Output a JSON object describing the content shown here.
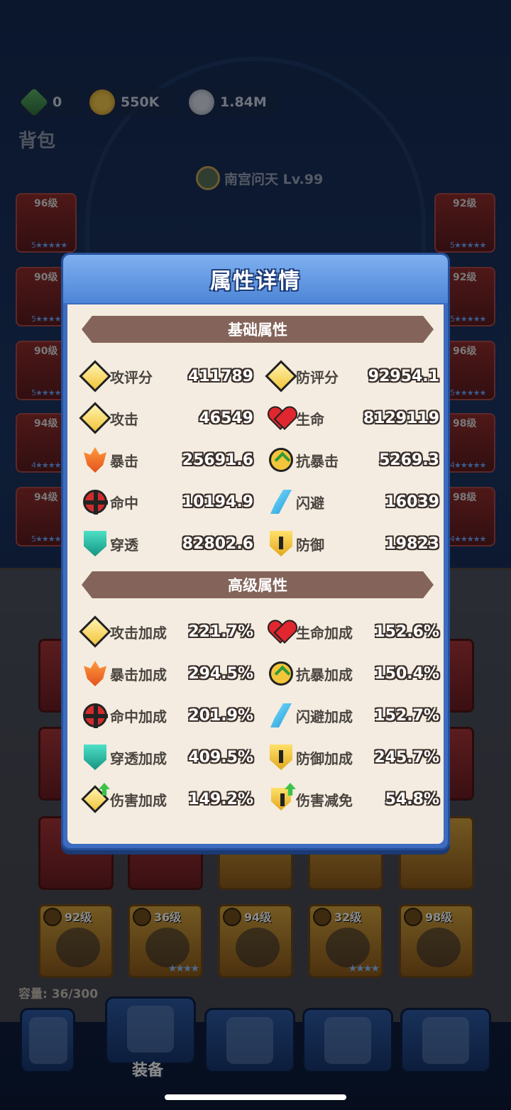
{
  "currency": {
    "gems": "0",
    "gold": "550K",
    "silver": "1.84M"
  },
  "bag_title": "背包",
  "hero": {
    "name": "南宫问天 Lv.99"
  },
  "left_slots": [
    {
      "level": "96级",
      "stars": "5★★★★★"
    },
    {
      "level": "90级",
      "stars": "5★★★★★"
    },
    {
      "level": "90级",
      "stars": "5★★★★★"
    },
    {
      "level": "94级",
      "stars": "4★★★★★"
    },
    {
      "level": "94级",
      "stars": "5★★★★★"
    }
  ],
  "right_slots": [
    {
      "level": "92级",
      "stars": "5★★★★★"
    },
    {
      "level": "92级",
      "stars": "5★★★★★"
    },
    {
      "level": "96级",
      "stars": "5★★★★★"
    },
    {
      "level": "98级",
      "stars": "4★★★★★"
    },
    {
      "level": "98级",
      "stars": "4★★★★★"
    }
  ],
  "inventory_row": [
    {
      "level": "92级",
      "stars": ""
    },
    {
      "level": "36级",
      "stars": "★★★★"
    },
    {
      "level": "94级",
      "stars": ""
    },
    {
      "level": "32级",
      "stars": "★★★★"
    },
    {
      "level": "98级",
      "stars": ""
    }
  ],
  "capacity": "容量: 36/300",
  "nav": {
    "equip_label": "装备"
  },
  "modal": {
    "title": "属性详情",
    "basic_title": "基础属性",
    "advanced_title": "高级属性",
    "basic": [
      {
        "name": "攻评分",
        "value": "411789",
        "icon": "gold-diamond-icon"
      },
      {
        "name": "防评分",
        "value": "92954.1",
        "icon": "gold-diamond-icon"
      },
      {
        "name": "攻击",
        "value": "46549",
        "icon": "gold-diamond-icon"
      },
      {
        "name": "生命",
        "value": "8129119",
        "icon": "heart-icon"
      },
      {
        "name": "暴击",
        "value": "25691.6",
        "icon": "fire-icon"
      },
      {
        "name": "抗暴击",
        "value": "5269.3",
        "icon": "chevron-shield-icon"
      },
      {
        "name": "命中",
        "value": "10194.9",
        "icon": "target-icon"
      },
      {
        "name": "闪避",
        "value": "16039",
        "icon": "feather-icon"
      },
      {
        "name": "穿透",
        "value": "82802.6",
        "icon": "teal-shield-icon"
      },
      {
        "name": "防御",
        "value": "19823",
        "icon": "gold-shield-icon"
      }
    ],
    "advanced": [
      {
        "name": "攻击加成",
        "value": "221.7%",
        "icon": "gold-diamond-icon"
      },
      {
        "name": "生命加成",
        "value": "152.6%",
        "icon": "heart-icon"
      },
      {
        "name": "暴击加成",
        "value": "294.5%",
        "icon": "fire-icon"
      },
      {
        "name": "抗暴加成",
        "value": "150.4%",
        "icon": "chevron-shield-icon"
      },
      {
        "name": "命中加成",
        "value": "201.9%",
        "icon": "target-icon"
      },
      {
        "name": "闪避加成",
        "value": "152.7%",
        "icon": "feather-icon"
      },
      {
        "name": "穿透加成",
        "value": "409.5%",
        "icon": "teal-shield-icon"
      },
      {
        "name": "防御加成",
        "value": "245.7%",
        "icon": "gold-shield-icon"
      },
      {
        "name": "伤害加成",
        "value": "149.2%",
        "icon": "damage-up-icon"
      },
      {
        "name": "伤害减免",
        "value": "54.8%",
        "icon": "damage-reduction-icon"
      }
    ]
  }
}
